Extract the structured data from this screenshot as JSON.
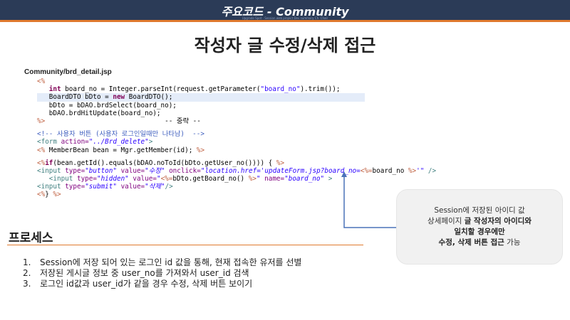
{
  "header": {
    "title": "주요코드 - Community",
    "subtitle": "Upgrade Spot - Session web project Dev summary Ch. Chair"
  },
  "slide": {
    "title": "작성자 글 수정/삭제 접근",
    "file_path": "Community/brd_detail.jsp"
  },
  "code": {
    "l1": "<%",
    "l2a": "int",
    "l2b": " board_no = Integer.parseInt(request.getParameter(",
    "l2c": "\"board_no\"",
    "l2d": ").trim());",
    "l3a": "BoardDTO bDto = ",
    "l3b": "new",
    "l3c": " BoardDTO();",
    "l4": "bDto = bDAO.brdSelect(board_no);",
    "l5": "bDAO.brdHitUpdate(board_no);",
    "l6a": "%>",
    "l6b": "-- 중략 --",
    "l7": "<!-- 사용자 버튼 (사용자 로그인일때만 나타남)  -->",
    "l8a": "<form ",
    "l8b": "action=",
    "l8c": "\"../Brd_delete\"",
    "l8d": ">",
    "l9a": "<% ",
    "l9b": "MemberBean bean = Mgr.getMember(id); ",
    "l9c": "%>",
    "l10a": "<%",
    "l10b": "if",
    "l10c": "(bean.getId().equals(bDAO.noToId(bDto.getUser_no()))) { ",
    "l10d": "%>",
    "l11a": "<input ",
    "l11b": "type=",
    "l11c": "\"button\"",
    "l11d": " value=",
    "l11e": "\"수정\"",
    "l11f": " onclick=",
    "l11g": "\"location.href='updateForm.jsp?board_no=",
    "l11h": "<%=",
    "l11i": "board_no ",
    "l11j": "%>",
    "l11k": "'\"",
    "l11l": " />",
    "l12a": "<input ",
    "l12b": "type=",
    "l12c": "\"hidden\"",
    "l12d": " value=",
    "l12e": "\"",
    "l12f": "<%=",
    "l12g": "bDto.getBoard_no() ",
    "l12h": "%>",
    "l12i": "\"",
    "l12j": " name=",
    "l12k": "\"board_no\"",
    "l12l": " >",
    "l13a": "<input ",
    "l13b": "type=",
    "l13c": "\"submit\"",
    "l13d": " value=",
    "l13e": "\"삭제\"",
    "l13f": "/>",
    "l14a": "<%",
    "l14b": "} ",
    "l14c": "%>"
  },
  "callout": {
    "line1": "Session에 저장된 아이디 값",
    "line2_pre": "상세페이지 ",
    "line2_bold": "글 작성자의 아이디와",
    "line3_bold": "일치할 경우에만",
    "line4_bold": "수정, 삭제 버튼 접근",
    "line4_post": " 가능"
  },
  "process": {
    "title": "프로세스",
    "steps": [
      {
        "num": "1.",
        "text": "Session에 저장 되어 있는 로그인 id 값을 통해, 현재 접속한 유저를 선별"
      },
      {
        "num": "2.",
        "text": "저장된 게시글 정보 중 user_no를 가져와서 user_id 검색"
      },
      {
        "num": "3.",
        "text": "로그인 id값과 user_id가 같을 경우 수정, 삭제 버튼 보이기"
      }
    ]
  },
  "colors": {
    "header_bg": "#2b3b57",
    "accent": "#e07a2e",
    "arrow": "#4a72b8"
  }
}
